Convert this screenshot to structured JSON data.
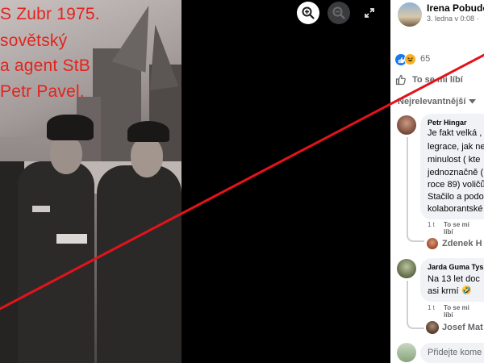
{
  "post": {
    "author": "Irena Pobudo",
    "date": "3. ledna v 0:08 ·",
    "reactions_count": "65",
    "like_action": "To se mi líbí",
    "sort_label": "Nejrelevantnější"
  },
  "photo": {
    "caption_lines": [
      "S Zubr 1975.",
      "sovětský",
      "a agent StB",
      "Petr Pavel."
    ]
  },
  "comments": [
    {
      "author": "Petr Hingar",
      "lines": [
        "Je fakt velká ,",
        "legrace, jak ne",
        "minulost ( kte",
        "jednoznačně (",
        "roce 89) voličů",
        "Stačilo a podo",
        "kolaborantské"
      ],
      "time": "1 t",
      "like_action": "To se mi líbí",
      "reply_author": "Zdenek H"
    },
    {
      "author": "Jarda Guma Tys",
      "lines": [
        "Na 13 let doc",
        "asi krmí"
      ],
      "emoji": "🤣",
      "time": "1 t",
      "like_action": "To se mi líbí",
      "reply_author": "Josef Mat"
    }
  ],
  "composer": {
    "placeholder": "Přidejte kome"
  },
  "colors": {
    "accent_blue": "#1877f2",
    "red_cross": "#e3131b",
    "caption_red": "#e3231f"
  },
  "icons": [
    "zoom-in-icon",
    "zoom-out-icon",
    "fullscreen-icon",
    "like-reaction-icon",
    "haha-reaction-icon",
    "like-icon",
    "dropdown-arrow-icon"
  ]
}
